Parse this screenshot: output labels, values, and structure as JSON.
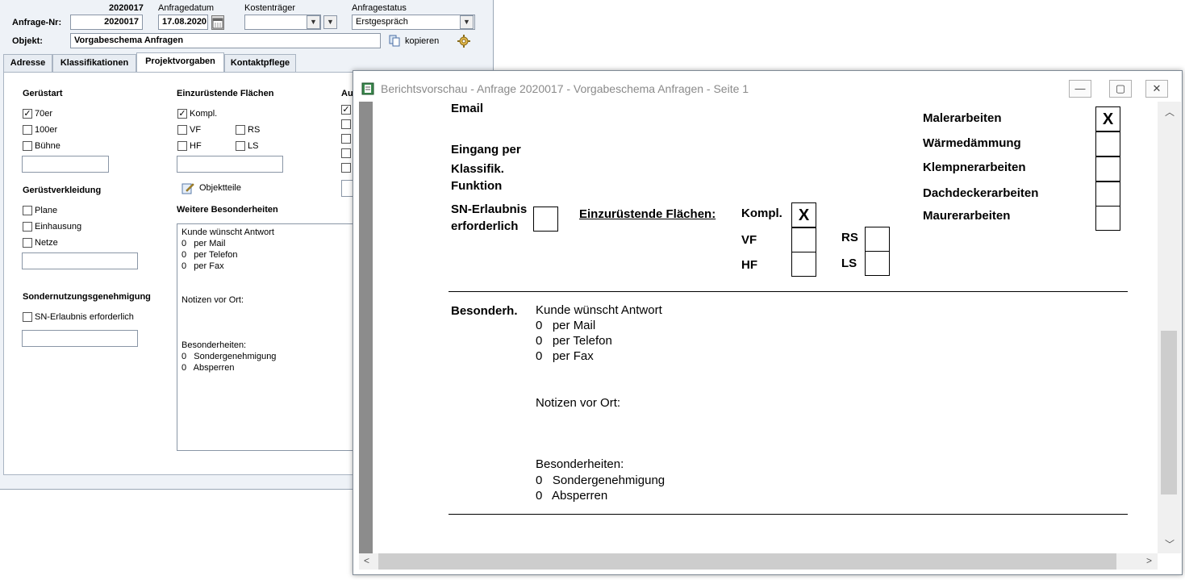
{
  "form": {
    "header": {
      "number_top": "2020017",
      "anfrage_nr_label": "Anfrage-Nr:",
      "anfrage_nr_value": "2020017",
      "anfragedatum_label": "Anfragedatum",
      "anfragedatum_value": "17.08.2020",
      "kostentraeger_label": "Kostenträger",
      "kostentraeger_value": "",
      "anfragestatus_label": "Anfragestatus",
      "anfragestatus_value": "Erstgespräch",
      "objekt_label": "Objekt:",
      "objekt_value": "Vorgabeschema Anfragen",
      "kopieren_label": "kopieren"
    },
    "tabs": [
      "Adresse",
      "Klassifikationen",
      "Projektvorgaben",
      "Kontaktpflege"
    ],
    "active_tab": "Projektvorgaben",
    "geruestart": {
      "title": "Gerüstart",
      "items": [
        {
          "label": "70er",
          "checked": true
        },
        {
          "label": "100er",
          "checked": false
        },
        {
          "label": "Bühne",
          "checked": false
        }
      ]
    },
    "geruestverkleidung": {
      "title": "Gerüstverkleidung",
      "items": [
        {
          "label": "Plane",
          "checked": false
        },
        {
          "label": "Einhausung",
          "checked": false
        },
        {
          "label": "Netze",
          "checked": false
        }
      ]
    },
    "sondernutzung": {
      "title": "Sondernutzungsgenehmigung",
      "items": [
        {
          "label": "SN-Erlaubnis erforderlich",
          "checked": false
        }
      ]
    },
    "flaechen": {
      "title": "Einzurüstende Flächen",
      "kompl": {
        "label": "Kompl.",
        "checked": true
      },
      "vf": {
        "label": "VF",
        "checked": false
      },
      "rs": {
        "label": "RS",
        "checked": false
      },
      "hf": {
        "label": "HF",
        "checked": false
      },
      "ls": {
        "label": "LS",
        "checked": false
      },
      "objektteile_label": "Objektteile"
    },
    "third_col_title": "Au",
    "weitere": {
      "title": "Weitere Besonderheiten",
      "lines": [
        "Kunde wünscht Antwort",
        "0   per Mail",
        "0   per Telefon",
        "0   per Fax",
        "Notizen vor Ort:",
        "Besonderheiten:",
        "0   Sondergenehmigung",
        "0   Absperren"
      ]
    }
  },
  "preview": {
    "title": "Berichtsvorschau - Anfrage 2020017 - Vorgabeschema Anfragen - Seite 1",
    "window_buttons": {
      "minimize": "—",
      "maximize": "▢",
      "close": "✕"
    },
    "labels": {
      "email": "Email",
      "eingang": "Eingang per",
      "klassifik": "Klassifik.",
      "funktion": "Funktion",
      "sn_line1": "SN-Erlaubnis",
      "sn_line2": "erforderlich",
      "flaechen": "Einzurüstende Flächen:",
      "kompl": "Kompl.",
      "vf": "VF",
      "hf": "HF",
      "rs": "RS",
      "ls": "LS",
      "besonderh": "Besonderh."
    },
    "marks": {
      "kompl": "X",
      "malerarbeiten": "X"
    },
    "trades": [
      {
        "label": "Malerarbeiten",
        "checked": true
      },
      {
        "label": "Wärmedämmung",
        "checked": false
      },
      {
        "label": "Klempnerarbeiten",
        "checked": false
      },
      {
        "label": "Dachdeckerarbeiten",
        "checked": false
      },
      {
        "label": "Maurerarbeiten",
        "checked": false
      }
    ],
    "notes_lines": [
      "Kunde wünscht Antwort",
      "0   per Mail",
      "0   per Telefon",
      "0   per Fax",
      "Notizen vor Ort:",
      "Besonderheiten:",
      "0   Sondergenehmigung",
      "0   Absperren"
    ]
  },
  "icons": {
    "calendar": "calendar-icon",
    "copy": "copy-icon",
    "settings": "gear-icon",
    "objektteile": "edit-icon",
    "app": "report-app-icon"
  }
}
